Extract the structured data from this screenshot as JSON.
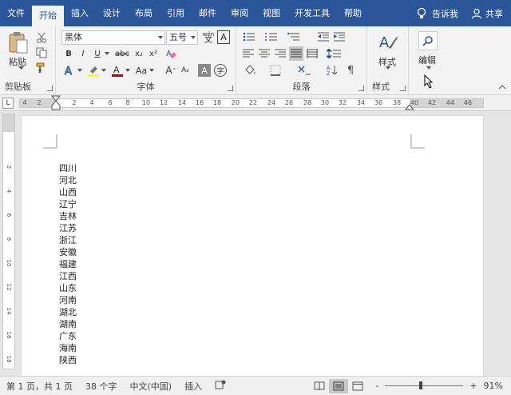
{
  "tabs": [
    {
      "label": "文件",
      "active": false
    },
    {
      "label": "开始",
      "active": true
    },
    {
      "label": "插入",
      "active": false
    },
    {
      "label": "设计",
      "active": false
    },
    {
      "label": "布局",
      "active": false
    },
    {
      "label": "引用",
      "active": false
    },
    {
      "label": "邮件",
      "active": false
    },
    {
      "label": "审阅",
      "active": false
    },
    {
      "label": "视图",
      "active": false
    },
    {
      "label": "开发工具",
      "active": false
    },
    {
      "label": "帮助",
      "active": false
    }
  ],
  "tellme": "告诉我",
  "share": "共享",
  "ribbon": {
    "clipboard": {
      "paste_label": "粘贴",
      "group_label": "剪贴板"
    },
    "font": {
      "font_name": "黑体",
      "font_size": "五号",
      "group_label": "字体",
      "bold": "B",
      "italic": "I",
      "underline": "U",
      "strike": "abc",
      "subscript": "x₂",
      "superscript": "x²",
      "grow": "A",
      "shrink": "A",
      "case": "Aa",
      "clear_format": "A",
      "char_border": "A",
      "enclosed": "字",
      "phonetic": "wén",
      "phonetic2": "文"
    },
    "paragraph": {
      "group_label": "段落"
    },
    "styles": {
      "label": "样式",
      "group_label": "样式"
    },
    "editing": {
      "label": "编辑"
    }
  },
  "ruler": {
    "corner": "L",
    "ticks": [
      "4",
      "2",
      "2",
      "4",
      "6",
      "8",
      "10",
      "12",
      "14",
      "16",
      "18",
      "20",
      "22",
      "24",
      "26",
      "28",
      "30",
      "32",
      "34",
      "36",
      "38",
      "40",
      "42",
      "44",
      "46"
    ],
    "vticks": [
      "2",
      "4",
      "6",
      "8",
      "10",
      "12",
      "14",
      "16",
      "18"
    ]
  },
  "document": {
    "lines": [
      "四川",
      "河北",
      "山西",
      "辽宁",
      "吉林",
      "江苏",
      "浙江",
      "安徽",
      "福建",
      "江西",
      "山东",
      "河南",
      "湖北",
      "湖南",
      "广东",
      "海南",
      "陕西"
    ]
  },
  "status": {
    "page": "第 1 页，共 1 页",
    "words": "38 个字",
    "language": "中文(中国)",
    "mode": "插入",
    "zoom_minus": "-",
    "zoom_plus": "+",
    "zoom_level": "91%",
    "zoom_fraction": 0.45
  },
  "colors": {
    "accent": "#2b579a",
    "highlight": "#ffff00",
    "font_color": "#c00000"
  }
}
